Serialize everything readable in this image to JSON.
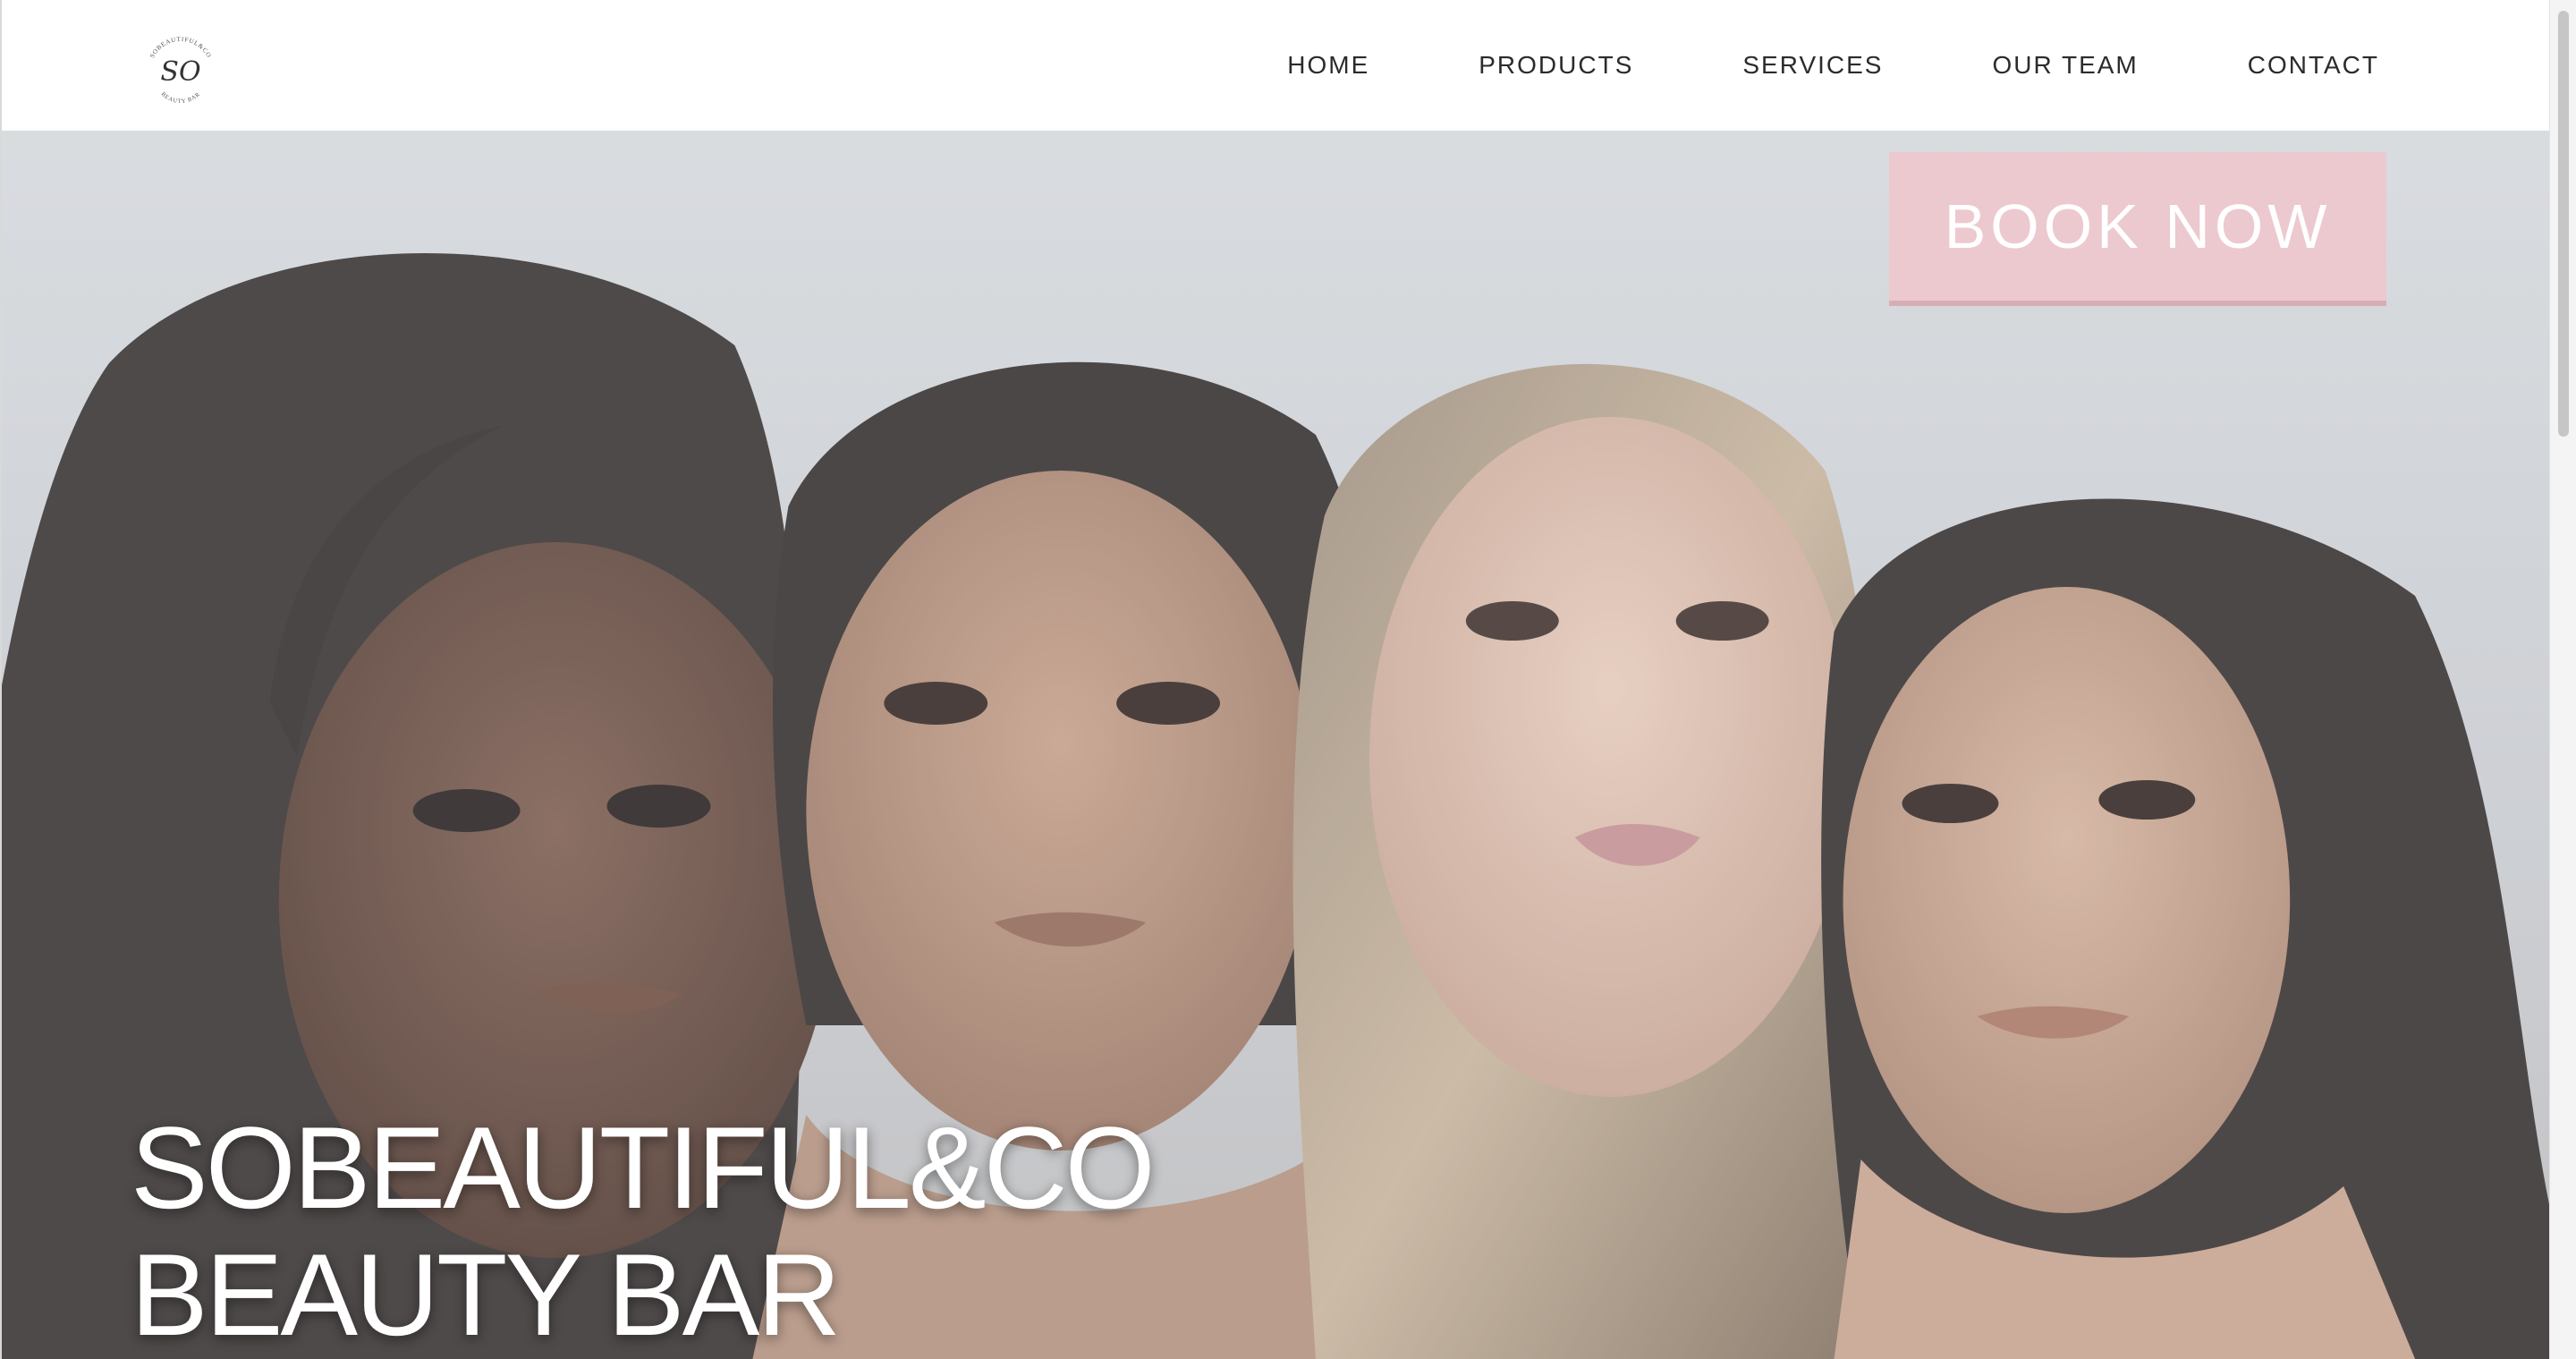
{
  "logo": {
    "arc_text_top": "SOBEAUTIFUL&CO",
    "monogram": "SO",
    "arc_text_bottom": "BEAUTY BAR"
  },
  "nav": {
    "items": [
      {
        "label": "HOME"
      },
      {
        "label": "PRODUCTS"
      },
      {
        "label": "SERVICES"
      },
      {
        "label": "OUR TEAM"
      },
      {
        "label": "CONTACT"
      }
    ]
  },
  "hero": {
    "cta_label": "BOOK NOW",
    "title_line1": "SOBEAUTIFUL&CO",
    "title_line2": "BEAUTY BAR"
  },
  "colors": {
    "cta_background": "#ecc9cf",
    "nav_text": "#2b2b2b",
    "hero_text": "#ffffff"
  }
}
